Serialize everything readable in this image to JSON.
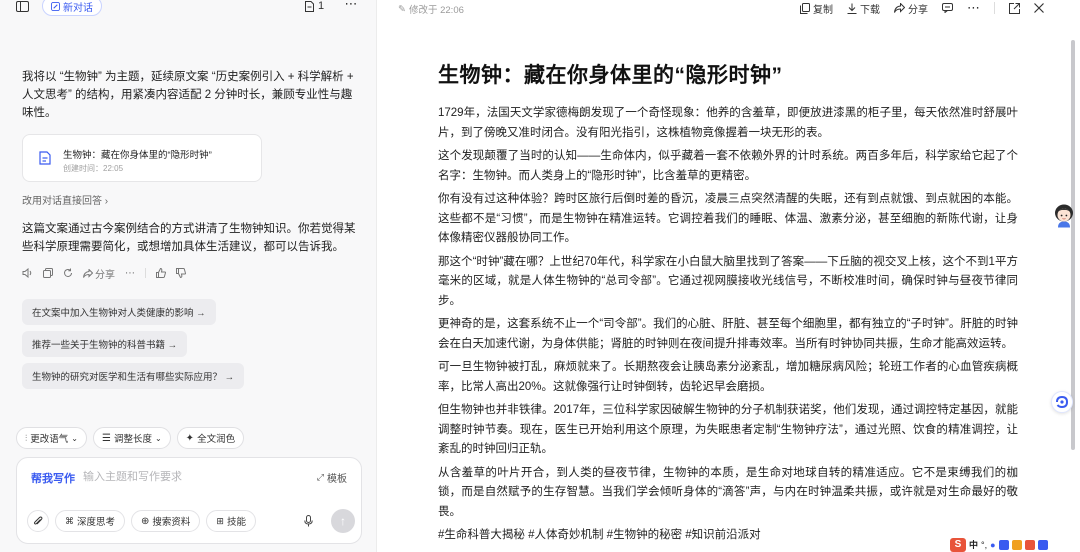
{
  "left": {
    "new_chat_label": "新对话",
    "doc_count": "1",
    "intro": "我将以 “生物钟” 为主题，延续原文案 “历史案例引入 + 科学解析 + 人文思考” 的结构，用紧凑内容适配 2 分钟时长，兼顾专业性与趣味性。",
    "doc_card": {
      "title": "生物钟：藏在你身体里的“隐形时钟”",
      "time": "创建时间：22:05"
    },
    "retry_label": "改用对话直接回答",
    "summary": "这篇文案通过古今案例结合的方式讲清了生物钟知识。你若觉得某些科学原理需要简化，或想增加具体生活建议，都可以告诉我。",
    "actions": {
      "share": "分享"
    },
    "suggestions": [
      "在文案中加入生物钟对人类健康的影响 →",
      "推荐一些关于生物钟的科普书籍 →",
      "生物钟的研究对医学和生活有哪些实际应用？ →"
    ],
    "tools": {
      "tone": "更改语气",
      "length": "调整长度",
      "polish": "全文润色"
    },
    "composer": {
      "label": "帮我写作",
      "placeholder": "输入主题和写作要求",
      "template": "模板",
      "deep_think": "深度思考",
      "search": "搜索资料",
      "skills": "技能"
    }
  },
  "right": {
    "modified": "修改于 22:06",
    "toolbar": {
      "copy": "复制",
      "download": "下载",
      "share": "分享"
    },
    "doc": {
      "title": "生物钟：藏在你身体里的“隐形时钟”",
      "paragraphs": [
        "1729年，法国天文学家德梅朗发现了一个奇怪现象：他养的含羞草，即便放进漆黑的柜子里，每天依然准时舒展叶片，到了傍晚又准时闭合。没有阳光指引，这株植物竟像握着一块无形的表。",
        "这个发现颠覆了当时的认知——生命体内，似乎藏着一套不依赖外界的计时系统。两百多年后，科学家给它起了个名字：生物钟。而人类身上的“隐形时钟”，比含羞草的更精密。",
        "你有没有过这种体验？跨时区旅行后倒时差的昏沉，凌晨三点突然清醒的失眠，还有到点就饿、到点就困的本能。这些都不是“习惯”，而是生物钟在精准运转。它调控着我们的睡眠、体温、激素分泌，甚至细胞的新陈代谢，让身体像精密仪器般协同工作。",
        "那这个“时钟”藏在哪？上世纪70年代，科学家在小白鼠大脑里找到了答案——下丘脑的视交叉上核，这个不到1平方毫米的区域，就是人体生物钟的“总司令部”。它通过视网膜接收光线信号，不断校准时间，确保时钟与昼夜节律同步。",
        "更神奇的是，这套系统不止一个“司令部”。我们的心脏、肝脏、甚至每个细胞里，都有独立的“子时钟”。肝脏的时钟会在白天加速代谢，为身体供能；肾脏的时钟则在夜间提升排毒效率。当所有时钟协同共振，生命才能高效运转。",
        "可一旦生物钟被打乱，麻烦就来了。长期熬夜会让胰岛素分泌紊乱，增加糖尿病风险；轮班工作者的心血管疾病概率，比常人高出20%。这就像强行让时钟倒转，齿轮迟早会磨损。",
        "但生物钟也并非铁律。2017年，三位科学家因破解生物钟的分子机制获诺奖，他们发现，通过调控特定基因，就能调整时钟节奏。现在，医生已开始利用这个原理，为失眠患者定制“生物钟疗法”，通过光照、饮食的精准调控，让紊乱的时钟回归正轨。",
        "从含羞草的叶片开合，到人类的昼夜节律，生物钟的本质，是生命对地球自转的精准适应。它不是束缚我们的枷锁，而是自然赋予的生存智慧。当我们学会倾听身体的“滴答”声，与内在时钟温柔共振，或许就是对生命最好的敬畏。"
      ],
      "tags": "#生命科普大揭秘 #人体奇妙机制 #生物钟的秘密 #知识前沿派对"
    }
  },
  "ime": {
    "lang": "中",
    "punct": "°,"
  },
  "colors": {
    "accent": "#3a5bf0",
    "panel_bg": "#f8f8f9",
    "chip_bg": "#ececef",
    "ime_red": "#e8543a"
  }
}
